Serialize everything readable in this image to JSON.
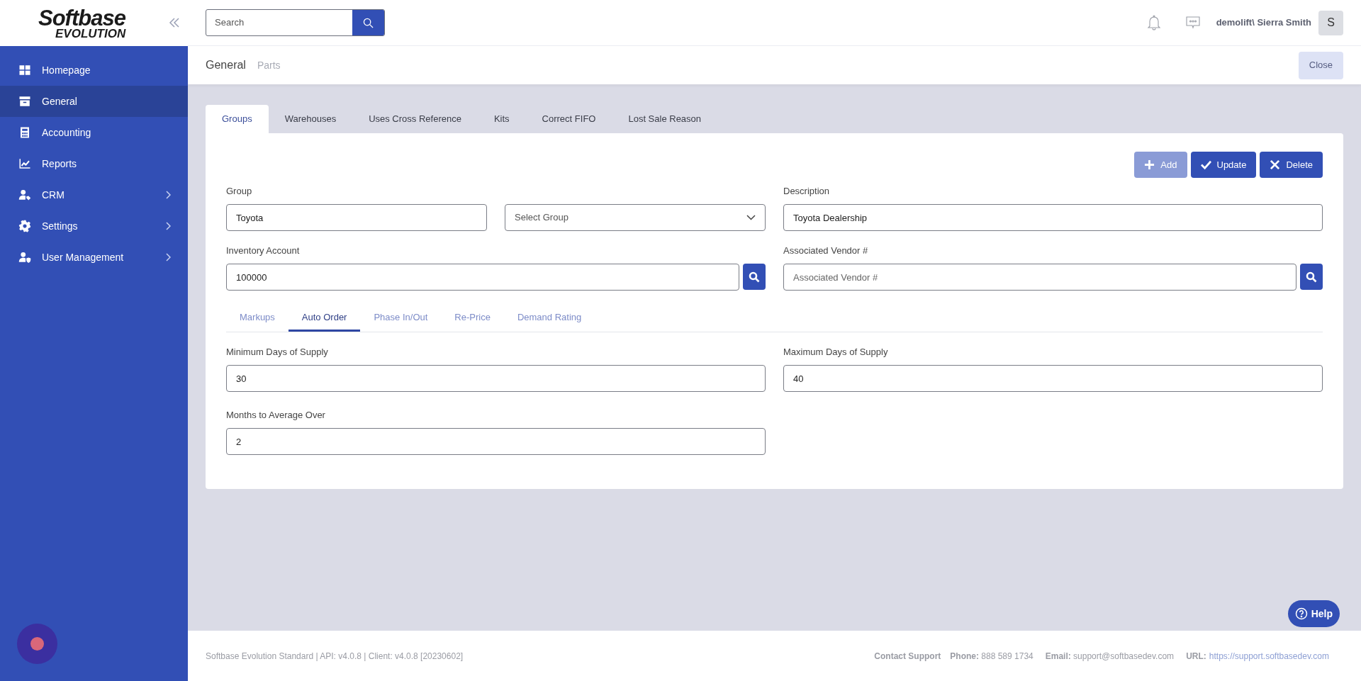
{
  "logo": {
    "name": "Softbase",
    "tagline": "EVOLUTION"
  },
  "sidebar": {
    "items": [
      {
        "label": "Homepage",
        "selected": false,
        "has_submenu": false
      },
      {
        "label": "General",
        "selected": true,
        "has_submenu": false
      },
      {
        "label": "Accounting",
        "selected": false,
        "has_submenu": false
      },
      {
        "label": "Reports",
        "selected": false,
        "has_submenu": false
      },
      {
        "label": "CRM",
        "selected": false,
        "has_submenu": true
      },
      {
        "label": "Settings",
        "selected": false,
        "has_submenu": true
      },
      {
        "label": "User Management",
        "selected": false,
        "has_submenu": true
      }
    ]
  },
  "search": {
    "placeholder": "Search"
  },
  "user": {
    "name": "demolift\\ Sierra Smith",
    "avatar": "S"
  },
  "breadcrumb": {
    "title": "General",
    "subtitle": "Parts"
  },
  "close_button": "Close",
  "tabs": [
    {
      "label": "Groups",
      "selected": true
    },
    {
      "label": "Warehouses",
      "selected": false
    },
    {
      "label": "Uses Cross Reference",
      "selected": false
    },
    {
      "label": "Kits",
      "selected": false
    },
    {
      "label": "Correct FIFO",
      "selected": false
    },
    {
      "label": "Lost Sale Reason",
      "selected": false
    }
  ],
  "actions": [
    {
      "label": "Add",
      "kind": "add",
      "disabled": true
    },
    {
      "label": "Update",
      "kind": "update",
      "disabled": false
    },
    {
      "label": "Delete",
      "kind": "delete",
      "disabled": false
    }
  ],
  "form": {
    "group": {
      "label": "Group",
      "value": "Toyota"
    },
    "group_select": {
      "placeholder": "Select Group"
    },
    "description": {
      "label": "Description",
      "value": "Toyota Dealership"
    },
    "inventory_account": {
      "label": "Inventory Account",
      "value": "100000"
    },
    "vendor": {
      "label": "Associated Vendor #",
      "placeholder": "Associated Vendor #"
    }
  },
  "subtabs": [
    {
      "label": "Markups",
      "selected": false
    },
    {
      "label": "Auto Order",
      "selected": true
    },
    {
      "label": "Phase In/Out",
      "selected": false
    },
    {
      "label": "Re-Price",
      "selected": false
    },
    {
      "label": "Demand Rating",
      "selected": false
    }
  ],
  "auto_order": {
    "min_days": {
      "label": "Minimum Days of Supply",
      "value": "30"
    },
    "max_days": {
      "label": "Maximum Days of Supply",
      "value": "40"
    },
    "months": {
      "label": "Months to Average Over",
      "value": "2"
    }
  },
  "footer": {
    "version": "Softbase Evolution Standard | API: v4.0.8 | Client: v4.0.8 [20230602]",
    "contact": "Contact Support",
    "phone_label": "Phone:",
    "phone": "888 589 1734",
    "email_label": "Email:",
    "email": "support@softbasedev.com",
    "url_label": "URL:",
    "url": "https://support.softbasedev.com"
  },
  "help_button": "Help"
}
